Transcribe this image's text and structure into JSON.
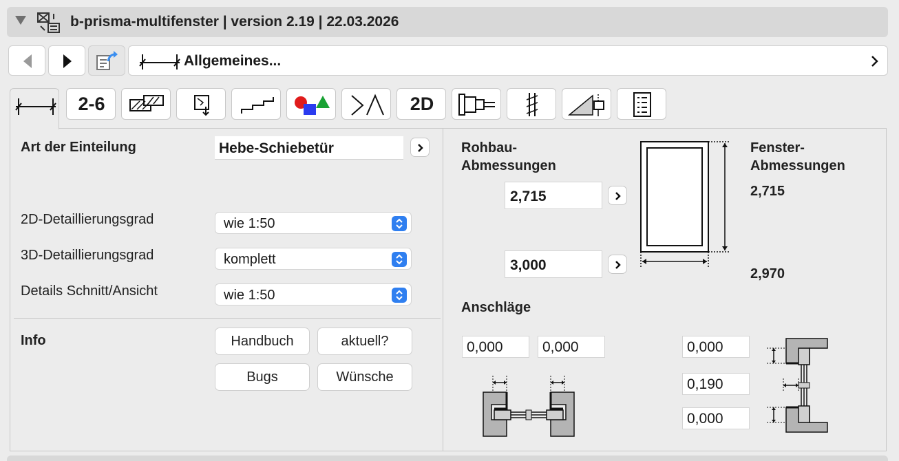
{
  "window": {
    "title": "b-prisma-multifenster | version 2.19 | 22.03.2026"
  },
  "nav": {
    "path_label": "Allgemeines..."
  },
  "tabs": [
    {
      "name": "general",
      "label": ""
    },
    {
      "name": "2-6",
      "label": "2-6"
    },
    {
      "name": "material",
      "label": ""
    },
    {
      "name": "opening",
      "label": ""
    },
    {
      "name": "sill",
      "label": ""
    },
    {
      "name": "colors",
      "label": ""
    },
    {
      "name": "opening-lines",
      "label": ""
    },
    {
      "name": "2d",
      "label": "2D"
    },
    {
      "name": "profile",
      "label": ""
    },
    {
      "name": "section",
      "label": ""
    },
    {
      "name": "reveal",
      "label": ""
    },
    {
      "name": "list",
      "label": ""
    }
  ],
  "left": {
    "division_label": "Art der Einteilung",
    "division_value": "Hebe-Schiebetür",
    "detail2d_label": "2D-Detaillierungsgrad",
    "detail2d_value": "wie 1:50",
    "detail3d_label": "3D-Detaillierungsgrad",
    "detail3d_value": "komplett",
    "section_label": "Details Schnitt/Ansicht",
    "section_value": "wie 1:50",
    "info_label": "Info",
    "buttons": {
      "manual": "Handbuch",
      "update": "aktuell?",
      "bugs": "Bugs",
      "wishes": "Wünsche"
    }
  },
  "right": {
    "rohbau_label_1": "Rohbau-",
    "rohbau_label_2": "Abmessungen",
    "fenster_label_1": "Fenster-",
    "fenster_label_2": "Abmessungen",
    "rohbau_height": "2,715",
    "rohbau_width": "3,000",
    "fenster_height": "2,715",
    "fenster_width": "2,970",
    "anschlaege_label": "Anschläge",
    "anschlag_left": "0,000",
    "anschlag_right": "0,000",
    "anschlag_top": "0,000",
    "anschlag_mid": "0,190",
    "anschlag_bottom": "0,000"
  },
  "colors": {
    "accent": "#2f7ff0",
    "panel": "#ececec",
    "header": "#d8d8d8"
  }
}
